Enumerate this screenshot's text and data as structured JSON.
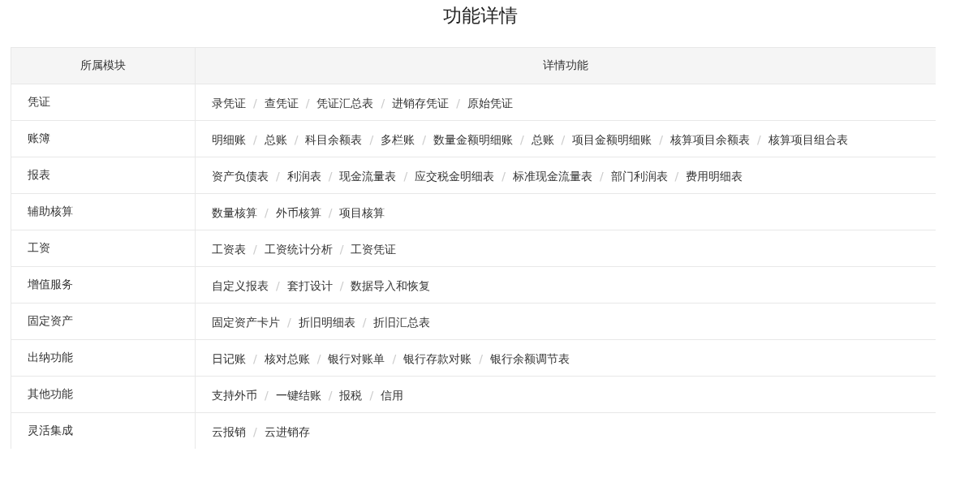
{
  "title": "功能详情",
  "table": {
    "columns": [
      "所属模块",
      "详情功能"
    ],
    "separator": "/",
    "rows": [
      {
        "module": "凭证",
        "features": [
          "录凭证",
          "查凭证",
          "凭证汇总表",
          "进销存凭证",
          "原始凭证"
        ]
      },
      {
        "module": "账簿",
        "features": [
          "明细账",
          "总账",
          "科目余额表",
          "多栏账",
          "数量金额明细账",
          "总账",
          "项目金额明细账",
          "核算项目余额表",
          "核算项目组合表"
        ]
      },
      {
        "module": "报表",
        "features": [
          "资产负债表",
          "利润表",
          "现金流量表",
          "应交税金明细表",
          "标准现金流量表",
          "部门利润表",
          "费用明细表"
        ]
      },
      {
        "module": "辅助核算",
        "features": [
          "数量核算",
          "外币核算",
          "项目核算"
        ]
      },
      {
        "module": "工资",
        "features": [
          "工资表",
          "工资统计分析",
          "工资凭证"
        ]
      },
      {
        "module": "增值服务",
        "features": [
          "自定义报表",
          "套打设计",
          "数据导入和恢复"
        ]
      },
      {
        "module": "固定资产",
        "features": [
          "固定资产卡片",
          "折旧明细表",
          "折旧汇总表"
        ]
      },
      {
        "module": "出纳功能",
        "features": [
          "日记账",
          "核对总账",
          "银行对账单",
          "银行存款对账",
          "银行余额调节表"
        ]
      },
      {
        "module": "其他功能",
        "features": [
          "支持外币",
          "一键结账",
          "报税",
          "信用"
        ]
      },
      {
        "module": "灵活集成",
        "features": [
          "云报销",
          "云进销存"
        ]
      }
    ]
  }
}
